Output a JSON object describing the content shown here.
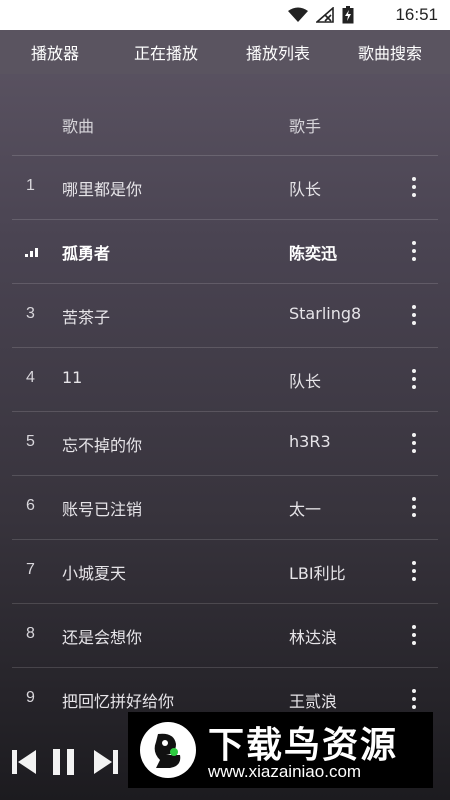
{
  "status_bar": {
    "time": "16:51",
    "icons": [
      "wifi-icon",
      "signal-off-icon",
      "battery-icon"
    ]
  },
  "tabs": [
    {
      "label": "播放器"
    },
    {
      "label": "正在播放"
    },
    {
      "label": "播放列表"
    },
    {
      "label": "歌曲搜索"
    }
  ],
  "header": {
    "song": "歌曲",
    "artist": "歌手"
  },
  "songs": [
    {
      "num": "1",
      "title": "哪里都是你",
      "artist": "队长",
      "playing": false
    },
    {
      "num": "",
      "title": "孤勇者",
      "artist": "陈奕迅",
      "playing": true
    },
    {
      "num": "3",
      "title": "苦茶子",
      "artist": "Starling8",
      "playing": false
    },
    {
      "num": "4",
      "title": "11",
      "artist": "队长",
      "playing": false
    },
    {
      "num": "5",
      "title": "忘不掉的你",
      "artist": "h3R3",
      "playing": false
    },
    {
      "num": "6",
      "title": "账号已注销",
      "artist": "太一",
      "playing": false
    },
    {
      "num": "7",
      "title": "小城夏天",
      "artist": "LBI利比",
      "playing": false
    },
    {
      "num": "8",
      "title": "还是会想你",
      "artist": "林达浪",
      "playing": false
    },
    {
      "num": "9",
      "title": "把回忆拼好给你",
      "artist": "王贰浪",
      "playing": false
    }
  ],
  "player_controls": [
    "previous-icon",
    "pause-icon",
    "next-icon"
  ],
  "watermark": {
    "text": "下载鸟资源",
    "url": "www.xiazainiao.com"
  },
  "colors": {
    "tab_bar": "#5a5460",
    "background_top": "#5f5766",
    "background_bottom": "#1c1b1f"
  }
}
